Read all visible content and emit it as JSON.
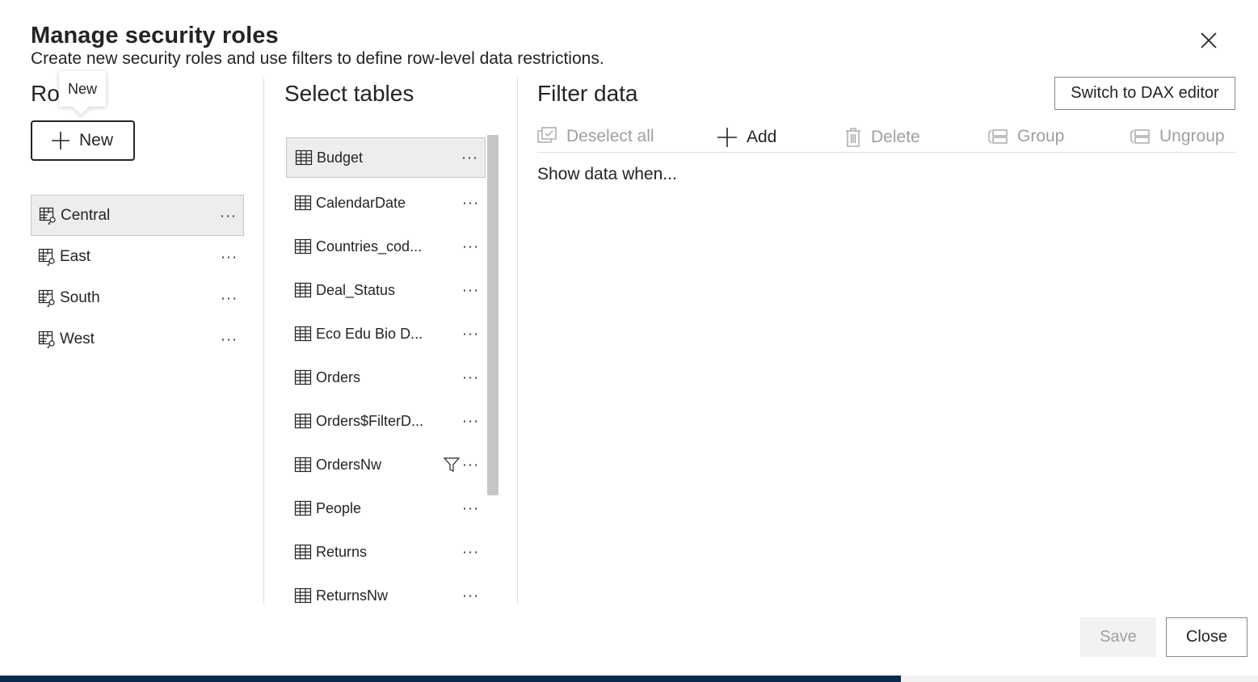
{
  "dialog": {
    "title": "Manage security roles",
    "subtitle": "Create new security roles and use filters to define row-level data restrictions."
  },
  "roles": {
    "heading": "Ro",
    "tooltip": "New",
    "new_button_label": "New",
    "items": [
      {
        "label": "Central",
        "selected": true
      },
      {
        "label": "East"
      },
      {
        "label": "South"
      },
      {
        "label": "West"
      }
    ]
  },
  "tables": {
    "heading": "Select tables",
    "items": [
      {
        "label": "Budget",
        "selected": true
      },
      {
        "label": "CalendarDate"
      },
      {
        "label": "Countries_cod..."
      },
      {
        "label": "Deal_Status"
      },
      {
        "label": "Eco Edu Bio D..."
      },
      {
        "label": "Orders"
      },
      {
        "label": "Orders$FilterD..."
      },
      {
        "label": "OrdersNw",
        "filtered": true
      },
      {
        "label": "People"
      },
      {
        "label": "Returns"
      },
      {
        "label": "ReturnsNw"
      }
    ],
    "more_label": "···"
  },
  "filter": {
    "heading": "Filter data",
    "dax_button": "Switch to DAX editor",
    "toolbar": {
      "deselect_all": "Deselect all",
      "add": "Add",
      "delete": "Delete",
      "group": "Group",
      "ungroup": "Ungroup"
    },
    "show_when": "Show data when..."
  },
  "footer": {
    "save": "Save",
    "close": "Close"
  },
  "colors": {
    "text": "#252423",
    "disabled": "#a19f9d",
    "selected_bg": "#ededed",
    "bottom_strip": "#0b2a4d"
  }
}
